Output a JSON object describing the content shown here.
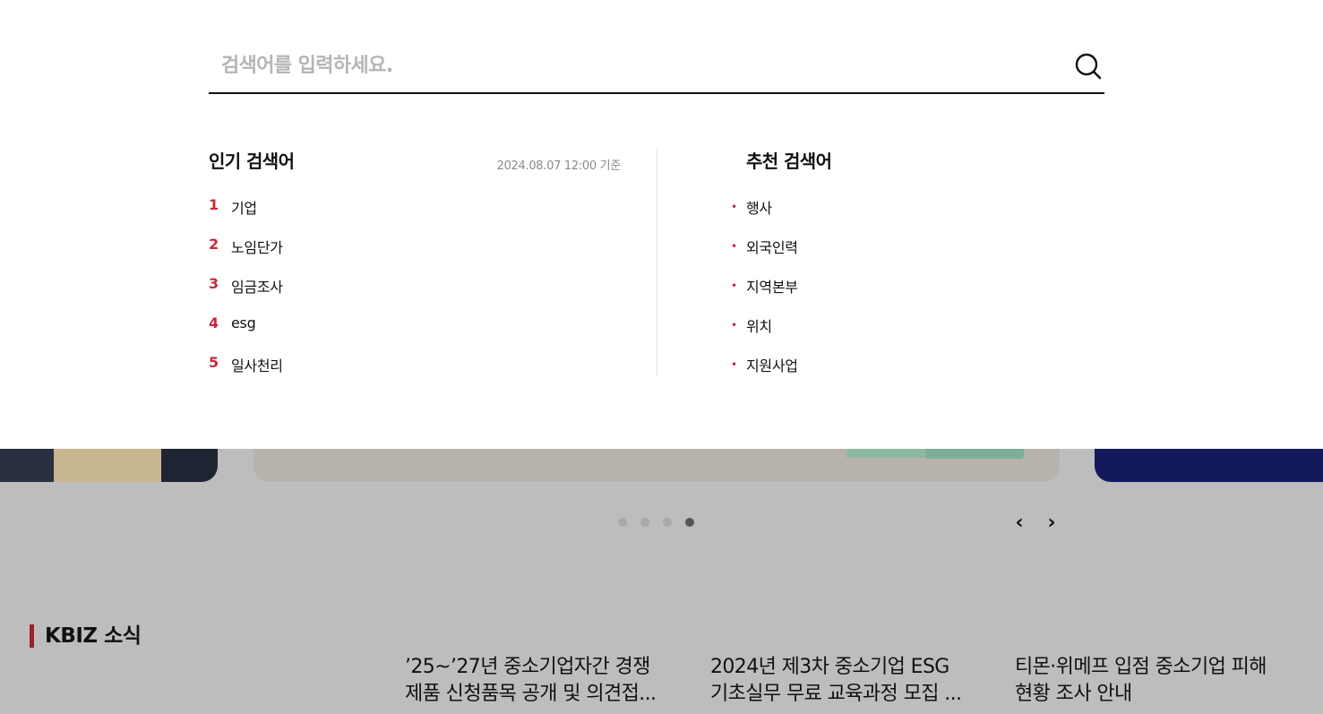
{
  "search": {
    "placeholder": "검색어를 입력하세요.",
    "value": "",
    "icon": "search-icon"
  },
  "popular": {
    "title": "인기 검색어",
    "basis": "2024.08.07 12:00 기준",
    "items": [
      {
        "rank": "1",
        "term": "기업"
      },
      {
        "rank": "2",
        "term": "노임단가"
      },
      {
        "rank": "3",
        "term": "임금조사"
      },
      {
        "rank": "4",
        "term": "esg"
      },
      {
        "rank": "5",
        "term": "일사천리"
      }
    ]
  },
  "recommended": {
    "title": "추천 검색어",
    "bullet": "•",
    "items": [
      {
        "term": "행사"
      },
      {
        "term": "외국인력"
      },
      {
        "term": "지역본부"
      },
      {
        "term": "위치"
      },
      {
        "term": "지원사업"
      }
    ]
  },
  "slider": {
    "dot_count": 4,
    "active_dot": 4,
    "prev_icon": "chevron-left-icon",
    "next_icon": "chevron-right-icon",
    "prev_glyph": "‹",
    "next_glyph": "›"
  },
  "kbiz": {
    "title": "KBIZ 소식",
    "news": [
      {
        "line1": "’25~’27년 중소기업자간 경쟁",
        "line2": "제품 신청품목 공개 및 의견접..."
      },
      {
        "line1": "2024년 제3차 중소기업 ESG",
        "line2": "기초실무 무료 교육과정 모집 ..."
      },
      {
        "line1": "티몬·위메프 입점 중소기업 피해",
        "line2": "현황 조사 안내"
      }
    ]
  },
  "colors": {
    "accent": "#c8283c",
    "kbiz_bar": "#9e1f32",
    "overlay_dim": "#bdbdbd"
  }
}
